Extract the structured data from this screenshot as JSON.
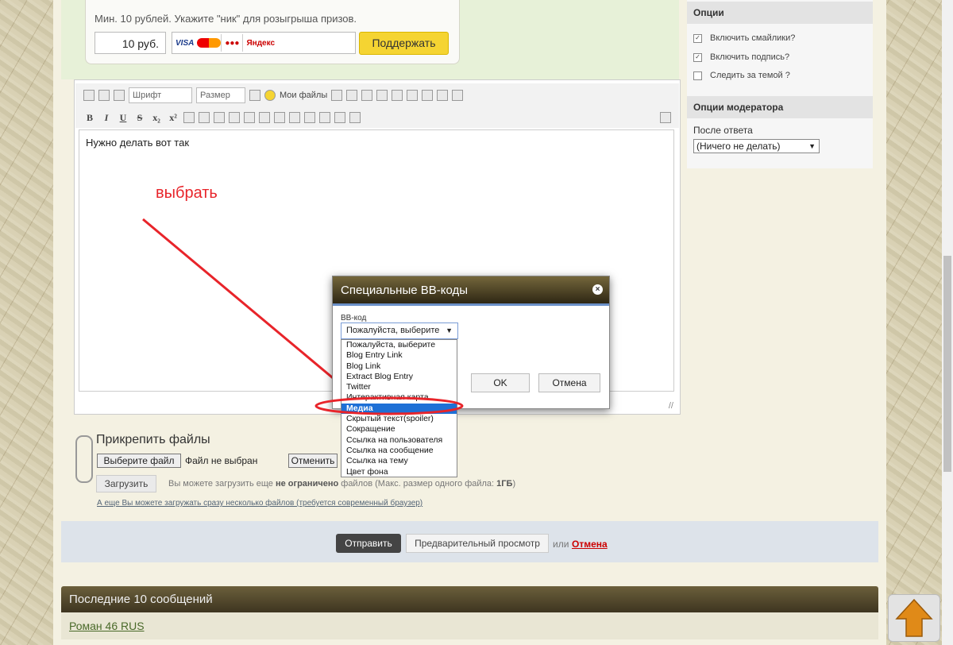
{
  "donate": {
    "text": "Мин. 10 рублей. Укажите \"ник\" для розыгрыша призов.",
    "amount": "10 руб.",
    "payments": [
      "VISA",
      "●●●",
      "Яндекс"
    ],
    "support_label": "Поддержать"
  },
  "toolbar": {
    "font_label": "Шрифт",
    "size_label": "Размер",
    "my_files_label": "Мои файлы",
    "format_buttons": [
      "B",
      "I",
      "U",
      "S",
      "x₂",
      "x²"
    ]
  },
  "editor": {
    "content": "Нужно делать вот так"
  },
  "annotation": {
    "text": "выбрать"
  },
  "attach": {
    "title": "Прикрепить файлы",
    "choose_label": "Выберите файл",
    "no_file_text": "Файл не выбран",
    "cancel_label": "Отменить",
    "upload_label": "Загрузить",
    "upload_note_prefix": "Вы можете загрузить еще",
    "upload_note_bold": "не ограничено",
    "upload_note_mid": "файлов (Макс. размер одного файла:",
    "upload_note_size": "1ГБ",
    "upload_note_end": ")",
    "multi_link": "А еще Вы можете загружать сразу несколько файлов (требуется современный браузер)"
  },
  "submit": {
    "send_label": "Отправить",
    "preview_label": "Предварительный просмотр",
    "or_text": "или",
    "cancel_label": "Отмена"
  },
  "last_posts": {
    "title": "Последние 10 сообщений",
    "user": "Роман 46 RUS"
  },
  "sidebar": {
    "options_title": "Опции",
    "options": [
      {
        "label": "Включить смайлики?",
        "checked": true
      },
      {
        "label": "Включить подпись?",
        "checked": true
      },
      {
        "label": "Следить за темой ?",
        "checked": false
      }
    ],
    "moderator_title": "Опции модератора",
    "after_label": "После ответа",
    "after_value": "(Ничего не делать)"
  },
  "modal": {
    "title": "Специальные BB-коды",
    "field_label": "BB-код",
    "selected": "Пожалуйста, выберите",
    "ok_label": "OK",
    "cancel_label": "Отмена",
    "options": [
      "Пожалуйста, выберите",
      "Blog Entry Link",
      "Blog Link",
      "Extract Blog Entry",
      "Twitter",
      "Интерактивная карта",
      "Медиа",
      "Скрытый текст(spoiler)",
      "Сокращение",
      "Ссылка на пользователя",
      "Ссылка на сообщение",
      "Ссылка на тему",
      "Цвет фона"
    ],
    "active_index": 6
  },
  "colors": {
    "accent": "#1e70d6",
    "annotation": "#e8242a",
    "support_button": "#f5d432",
    "header_dark": "#3e3520"
  }
}
